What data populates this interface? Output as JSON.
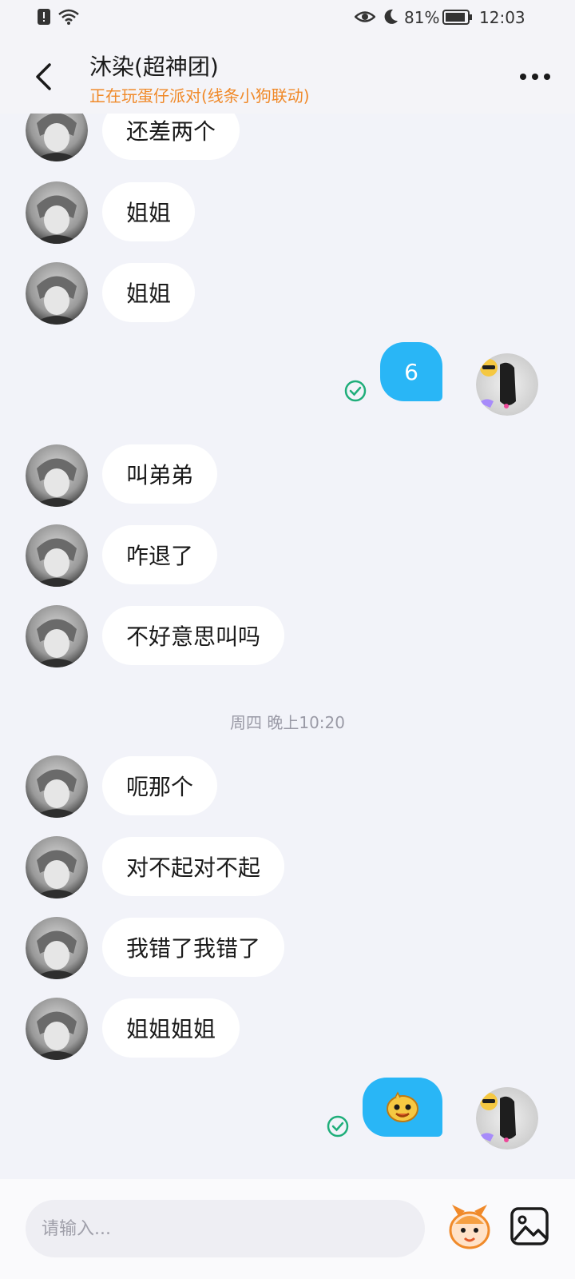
{
  "status_bar": {
    "battery": "81%",
    "time": "12:03"
  },
  "header": {
    "title": "沐染(超神团)",
    "subtitle": "正在玩蛋仔派对(线条小狗联动)"
  },
  "messages": [
    {
      "direction": "in",
      "text": "还差两个"
    },
    {
      "direction": "in",
      "text": "姐姐"
    },
    {
      "direction": "in",
      "text": "姐姐"
    },
    {
      "direction": "out",
      "text": "6",
      "read": true
    },
    {
      "direction": "in",
      "text": "叫弟弟"
    },
    {
      "direction": "in",
      "text": "咋退了"
    },
    {
      "direction": "in",
      "text": "不好意思叫吗"
    },
    {
      "direction": "in",
      "text": "呃那个"
    },
    {
      "direction": "in",
      "text": "对不起对不起"
    },
    {
      "direction": "in",
      "text": "我错了我错了"
    },
    {
      "direction": "in",
      "text": "姐姐姐姐"
    },
    {
      "direction": "out",
      "emoji": "emoji-face-sticker",
      "read": true
    }
  ],
  "timestamp": "周四 晚上10:20",
  "input": {
    "placeholder": "请输入..."
  },
  "colors": {
    "outgoing_bubble": "#29b6f6",
    "incoming_bubble": "#ffffff",
    "subtitle": "#f08a2a",
    "read_check": "#1fae7a"
  },
  "icons": {
    "back": "chevron-left-icon",
    "more": "more-dots-icon",
    "emoji": "sticker-emoji-icon",
    "image": "image-gallery-icon"
  }
}
